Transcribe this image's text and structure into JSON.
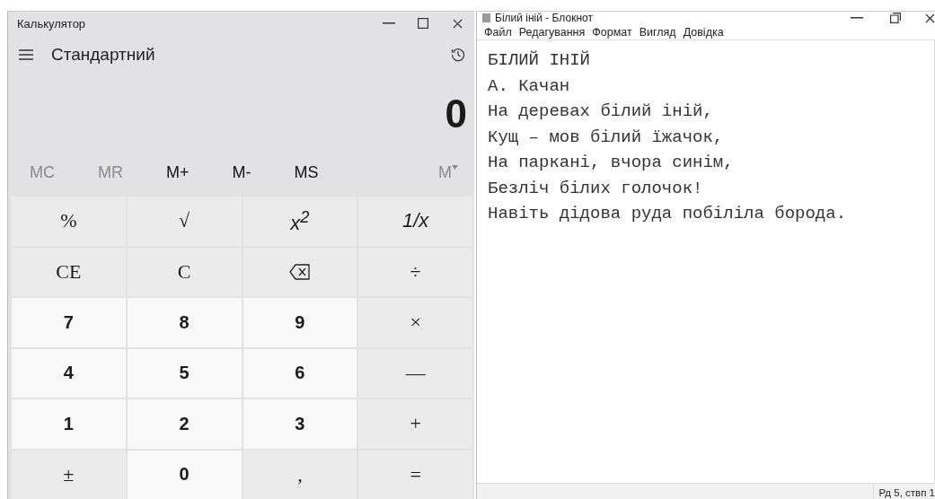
{
  "calculator": {
    "title": "Калькулятор",
    "mode": "Стандартний",
    "display": "0",
    "memory": [
      {
        "label": "MC",
        "disabled": true,
        "kind": "plain"
      },
      {
        "label": "MR",
        "disabled": true,
        "kind": "plain"
      },
      {
        "label": "M+",
        "disabled": false,
        "kind": "plain"
      },
      {
        "label": "M-",
        "disabled": false,
        "kind": "plain"
      },
      {
        "label": "MS",
        "disabled": false,
        "kind": "plain"
      },
      {
        "label": "M",
        "disabled": true,
        "kind": "dropdown"
      }
    ],
    "keys": [
      {
        "label": "%",
        "kind": "function"
      },
      {
        "label": "√",
        "kind": "function"
      },
      {
        "label": "x$^{2}$",
        "kind": "function"
      },
      {
        "label": "1/x",
        "kind": "function"
      },
      {
        "label": "CE",
        "kind": "function"
      },
      {
        "label": "C",
        "kind": "function"
      },
      {
        "kind": "backspace"
      },
      {
        "label": "÷",
        "kind": "function"
      },
      {
        "label": "7",
        "kind": "digit"
      },
      {
        "label": "8",
        "kind": "digit"
      },
      {
        "label": "9",
        "kind": "digit"
      },
      {
        "label": "×",
        "kind": "function"
      },
      {
        "label": "4",
        "kind": "digit"
      },
      {
        "label": "5",
        "kind": "digit"
      },
      {
        "label": "6",
        "kind": "digit"
      },
      {
        "label": "—",
        "kind": "function"
      },
      {
        "label": "1",
        "kind": "digit"
      },
      {
        "label": "2",
        "kind": "digit"
      },
      {
        "label": "3",
        "kind": "digit"
      },
      {
        "label": "+",
        "kind": "function"
      },
      {
        "label": "±",
        "kind": "function"
      },
      {
        "label": "0",
        "kind": "digit"
      },
      {
        "label": ",",
        "kind": "function"
      },
      {
        "label": "=",
        "kind": "function"
      }
    ]
  },
  "notepad": {
    "title": "Білий іній - Блокнот",
    "menu": [
      "Файл",
      "Редагування",
      "Формат",
      "Вигляд",
      "Довідка"
    ],
    "lines": [
      "БІЛИЙ ІНІЙ",
      "А. Качан",
      "На деревах білий іній,",
      "Кущ – мов білий їжачок,",
      "На паркані, вчора синім,",
      "Безліч білих голочок!",
      "Навіть дідова руда побіліла борода."
    ],
    "status_bar": "Рд 5, ствп 1"
  }
}
